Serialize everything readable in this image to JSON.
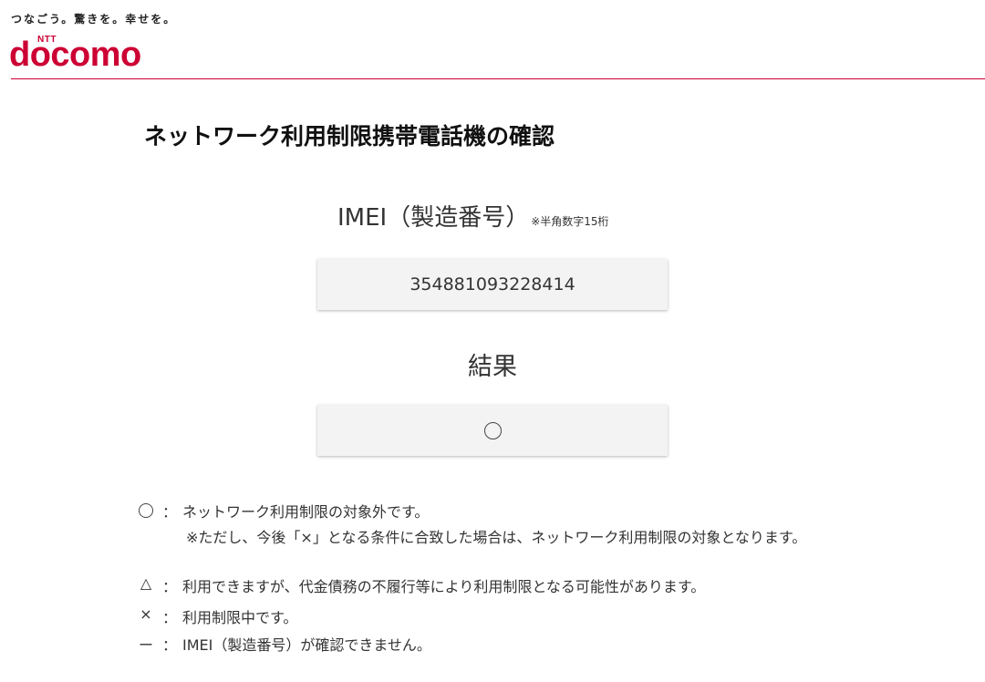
{
  "header": {
    "tagline": "つなごう。驚きを。幸せを。",
    "logo_ntt": "NTT",
    "logo_word": "docomo",
    "brand_color": "#cc0033"
  },
  "page": {
    "title": "ネットワーク利用制限携帯電話機の確認"
  },
  "imei": {
    "label": "IMEI（製造番号）",
    "note": "※半角数字15桁",
    "value": "354881093228414"
  },
  "result": {
    "label": "結果",
    "value_icon": "circle-icon"
  },
  "legend": {
    "rows": [
      {
        "symbol_icon": "circle-icon",
        "colon": "：",
        "text": "ネットワーク利用制限の対象外です。",
        "note": "※ただし、今後「×」となる条件に合致した場合は、ネットワーク利用制限の対象となります。"
      },
      {
        "symbol": "△",
        "colon": "：",
        "text": "利用できますが、代金債務の不履行等により利用制限となる可能性があります。"
      },
      {
        "symbol": "×",
        "colon": "：",
        "text": "利用制限中です。"
      },
      {
        "symbol": "ー",
        "colon": "：",
        "text": "IMEI（製造番号）が確認できません。"
      }
    ]
  }
}
